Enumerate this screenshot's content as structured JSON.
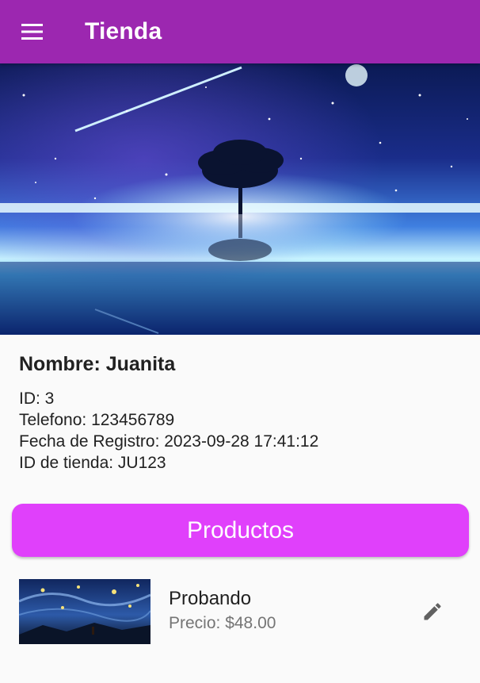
{
  "appbar": {
    "title": "Tienda",
    "menu_icon": "menu-icon",
    "color": "#9c27b0"
  },
  "store": {
    "name_line": "Nombre: Juanita",
    "id_line": "ID: 3",
    "phone_line": "Telefono: 123456789",
    "registered_line": "Fecha de Registro: 2023-09-28 17:41:12",
    "store_id_line": "ID de tienda: JU123"
  },
  "products_button": {
    "label": "Productos",
    "color": "#e040fb"
  },
  "products": [
    {
      "name": "Probando",
      "price_line": "Precio: $48.00",
      "action_icon": "edit-icon"
    }
  ]
}
